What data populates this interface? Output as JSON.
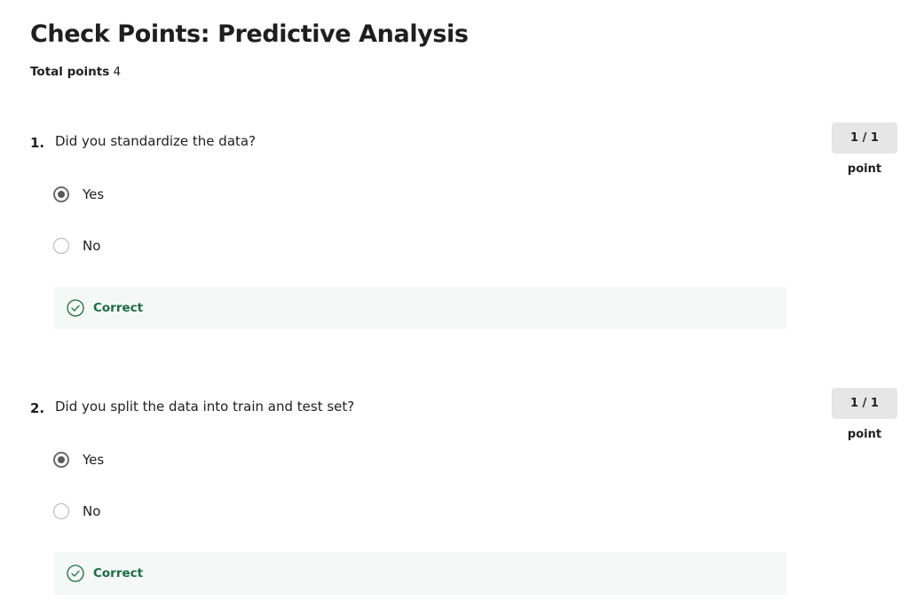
{
  "page": {
    "title": "Check Points: Predictive Analysis",
    "total_points_label": "Total points",
    "total_points_value": "4"
  },
  "questions": [
    {
      "number": "1.",
      "text": "Did you standardize the data?",
      "points": "1 / 1 point",
      "options": [
        {
          "label": "Yes",
          "selected": true
        },
        {
          "label": "No",
          "selected": false
        }
      ],
      "feedback": "Correct"
    },
    {
      "number": "2.",
      "text": "Did you split the data into train and test set?",
      "points": "1 / 1 point",
      "options": [
        {
          "label": "Yes",
          "selected": true
        },
        {
          "label": "No",
          "selected": false
        }
      ],
      "feedback": "Correct"
    }
  ],
  "colors": {
    "correct_text": "#1e6b46",
    "correct_bg": "#f4f8f7",
    "badge_bg": "#e6e6e6",
    "radio_selected": "#5a5a5a"
  },
  "icons": {
    "feedback": "check-circle-icon",
    "radio_selected": "radio-selected-icon",
    "radio_unselected": "radio-unselected-icon"
  }
}
